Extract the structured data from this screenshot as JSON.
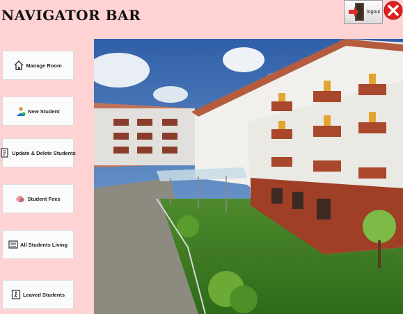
{
  "header": {
    "title": "NAVIGATOR BAR",
    "logout_label": "logout"
  },
  "sidebar": {
    "items": [
      {
        "label": "Manage Room",
        "icon": "home-icon"
      },
      {
        "label": "New Student",
        "icon": "student-icon"
      },
      {
        "label": "Update & Delete Students",
        "icon": "edit-document-icon"
      },
      {
        "label": "Student Fees",
        "icon": "fees-icon"
      },
      {
        "label": "All Students Living",
        "icon": "list-icon"
      },
      {
        "label": "Leaved Students",
        "icon": "exit-icon"
      }
    ]
  },
  "colors": {
    "background": "#ffd3d3",
    "close_red": "#e02020"
  }
}
